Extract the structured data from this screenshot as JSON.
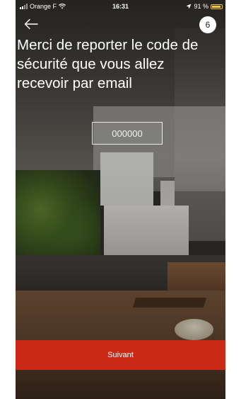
{
  "status_bar": {
    "carrier": "Orange F",
    "time": "16:31",
    "battery": "91 %",
    "battery_level": 0.91
  },
  "nav": {
    "step": "6"
  },
  "title": "Merci de reporter le code de sécurité que vous allez recevoir par email",
  "code_field": {
    "placeholder": "000000"
  },
  "primary_button": {
    "label": "Suivant"
  },
  "colors": {
    "accent": "#cc2a16",
    "battery": "#f4c63a"
  }
}
